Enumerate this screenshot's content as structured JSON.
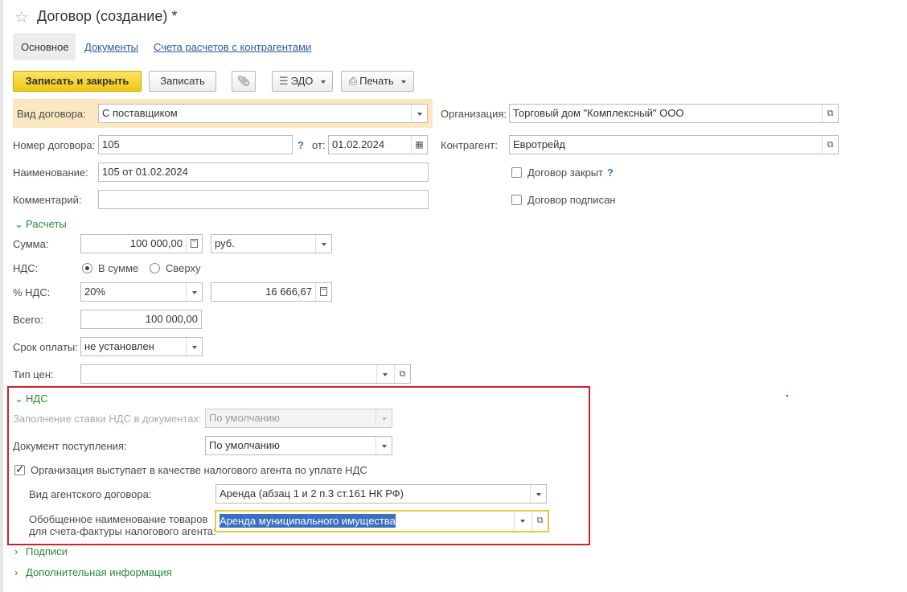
{
  "window": {
    "title": "Договор (создание) *"
  },
  "tabs": [
    {
      "label": "Основное"
    },
    {
      "label": "Документы"
    },
    {
      "label": "Счета расчетов с контрагентами"
    }
  ],
  "toolbar": {
    "save_close": "Записать и закрыть",
    "save": "Записать",
    "edo": "ЭДО",
    "print": "Печать"
  },
  "form": {
    "contract_type": {
      "label": "Вид договора:",
      "value": "С поставщиком"
    },
    "organization": {
      "label": "Организация:",
      "value": "Торговый дом \"Комплексный\" ООО"
    },
    "number": {
      "label": "Номер договора:",
      "value": "105"
    },
    "date": {
      "label": "от:",
      "value": "01.02.2024"
    },
    "counterparty": {
      "label": "Контрагент:",
      "value": "Евротрейд"
    },
    "name": {
      "label": "Наименование:",
      "value": "105 от 01.02.2024"
    },
    "comment": {
      "label": "Комментарий:",
      "value": ""
    },
    "closed": {
      "label": "Договор закрыт",
      "checked": false
    },
    "signed": {
      "label": "Договор подписан",
      "checked": false
    }
  },
  "calc": {
    "title": "Расчеты",
    "sum_label": "Сумма:",
    "sum_value": "100 000,00",
    "currency": "руб.",
    "vat_label": "НДС:",
    "vat_in_sum": "В сумме",
    "vat_over": "Сверху",
    "vat_pct_label": "% НДС:",
    "vat_pct_value": "20%",
    "vat_amount": "16 666,67",
    "total_label": "Всего:",
    "total_value": "100 000,00",
    "term_label": "Срок оплаты:",
    "term_value": "не установлен",
    "price_type_label": "Тип цен:",
    "price_type_value": ""
  },
  "vat": {
    "title": "НДС",
    "fill_rate_label": "Заполнение ставки НДС в документах:",
    "fill_rate_value": "По умолчанию",
    "receipt_doc_label": "Документ поступления:",
    "receipt_doc_value": "По умолчанию",
    "tax_agent_label": "Организация выступает в качестве налогового агента по уплате НДС",
    "tax_agent_checked": true,
    "agent_contract_label": "Вид агентского договора:",
    "agent_contract_value": "Аренда (абзац 1 и 2 п.3 ст.161 НК РФ)",
    "goods_name_label_1": "Обобщенное наименование товаров",
    "goods_name_label_2": "для счета-фактуры налогового агента:",
    "goods_name_value": "Аренда муниципального имущества"
  },
  "sections": {
    "signatures": "Подписи",
    "additional": "Дополнительная информация"
  },
  "colors": {
    "accent_yellow": "#f5d11d",
    "section_green": "#2a8a3a",
    "highlight_red": "#d0202a",
    "focus_yellow": "#e8c93a",
    "selection_blue": "#3a6fc2"
  }
}
